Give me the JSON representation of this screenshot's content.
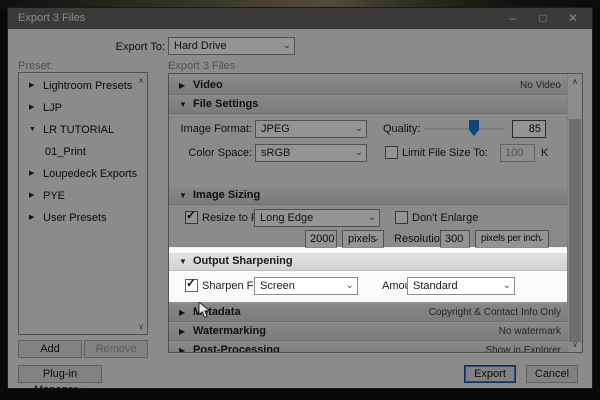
{
  "window": {
    "title": "Export 3 Files",
    "export_to_label": "Export To:",
    "export_to_value": "Hard Drive"
  },
  "icons": {
    "collapsed": "▶",
    "expanded": "▼",
    "chevron_down": "⌄",
    "check": "✓",
    "scroll_up": "∧",
    "scroll_down": "∨",
    "minimize": "–",
    "maximize": "□",
    "close": "✕"
  },
  "presets_panel": {
    "label": "Preset:",
    "items": [
      {
        "label": "Lightroom Presets",
        "arrow": "▶"
      },
      {
        "label": "LJP",
        "arrow": "▶"
      },
      {
        "label": "LR TUTORIAL",
        "arrow": "▼"
      },
      {
        "label": "01_Print",
        "arrow": ""
      },
      {
        "label": "Loupedeck Exports",
        "arrow": "▶"
      },
      {
        "label": "PYE",
        "arrow": "▶"
      },
      {
        "label": "User Presets",
        "arrow": "▶"
      }
    ],
    "add_button": "Add",
    "remove_button": "Remove"
  },
  "settings_panel": {
    "label": "Export 3 Files",
    "video": {
      "title": "Video",
      "status": "No Video"
    },
    "file_settings": {
      "title": "File Settings",
      "image_format_label": "Image Format:",
      "image_format_value": "JPEG",
      "quality_label": "Quality:",
      "quality_value": "85",
      "color_space_label": "Color Space:",
      "color_space_value": "sRGB",
      "limit_label": "Limit File Size To:",
      "limit_value": "100",
      "limit_unit": "K"
    },
    "image_sizing": {
      "title": "Image Sizing",
      "resize_label": "Resize to Fit:",
      "resize_value": "Long Edge",
      "dont_enlarge_label": "Don't Enlarge",
      "size_value": "2000",
      "size_unit": "pixels",
      "resolution_label": "Resolution:",
      "resolution_value": "300",
      "resolution_unit": "pixels per inch"
    },
    "output_sharpening": {
      "title": "Output Sharpening",
      "sharpen_label": "Sharpen For:",
      "sharpen_value": "Screen",
      "amount_label": "Amount:",
      "amount_value": "Standard"
    },
    "metadata": {
      "title": "Metadata",
      "status": "Copyright & Contact Info Only"
    },
    "watermarking": {
      "title": "Watermarking",
      "status": "No watermark"
    },
    "post_processing": {
      "title": "Post-Processing",
      "status": "Show in Explorer"
    }
  },
  "footer": {
    "plugin_manager_button": "Plug-in Manager...",
    "export_button": "Export",
    "cancel_button": "Cancel"
  },
  "colors": {
    "accent_blue": "#1976d2",
    "spotlight_bg": "#fbfbfb"
  }
}
